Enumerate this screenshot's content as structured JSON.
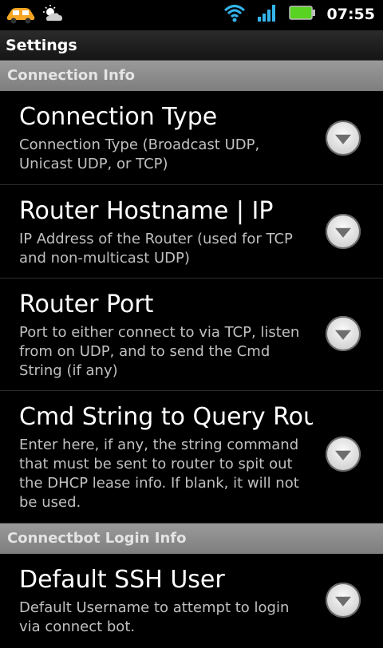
{
  "status_bar": {
    "time": "07:55"
  },
  "title_bar": {
    "title": "Settings"
  },
  "sections": [
    {
      "header": "Connection Info",
      "items": [
        {
          "title": "Connection Type",
          "summary": "Connection Type (Broadcast UDP, Unicast UDP, or TCP)"
        },
        {
          "title": "Router Hostname | IP",
          "summary": "IP Address of the Router (used for TCP and non-multicast UDP)"
        },
        {
          "title": "Router Port",
          "summary": "Port to either connect to via TCP, listen from on UDP, and to send the Cmd String (if any)"
        },
        {
          "title": "Cmd String to Query Router",
          "summary": "Enter here, if any, the string command that must be sent to router to spit out the DHCP lease info. If blank, it will not be used."
        }
      ]
    },
    {
      "header": "Connectbot Login Info",
      "items": [
        {
          "title": "Default SSH User",
          "summary": "Default Username to attempt to login via connect bot."
        }
      ]
    }
  ]
}
